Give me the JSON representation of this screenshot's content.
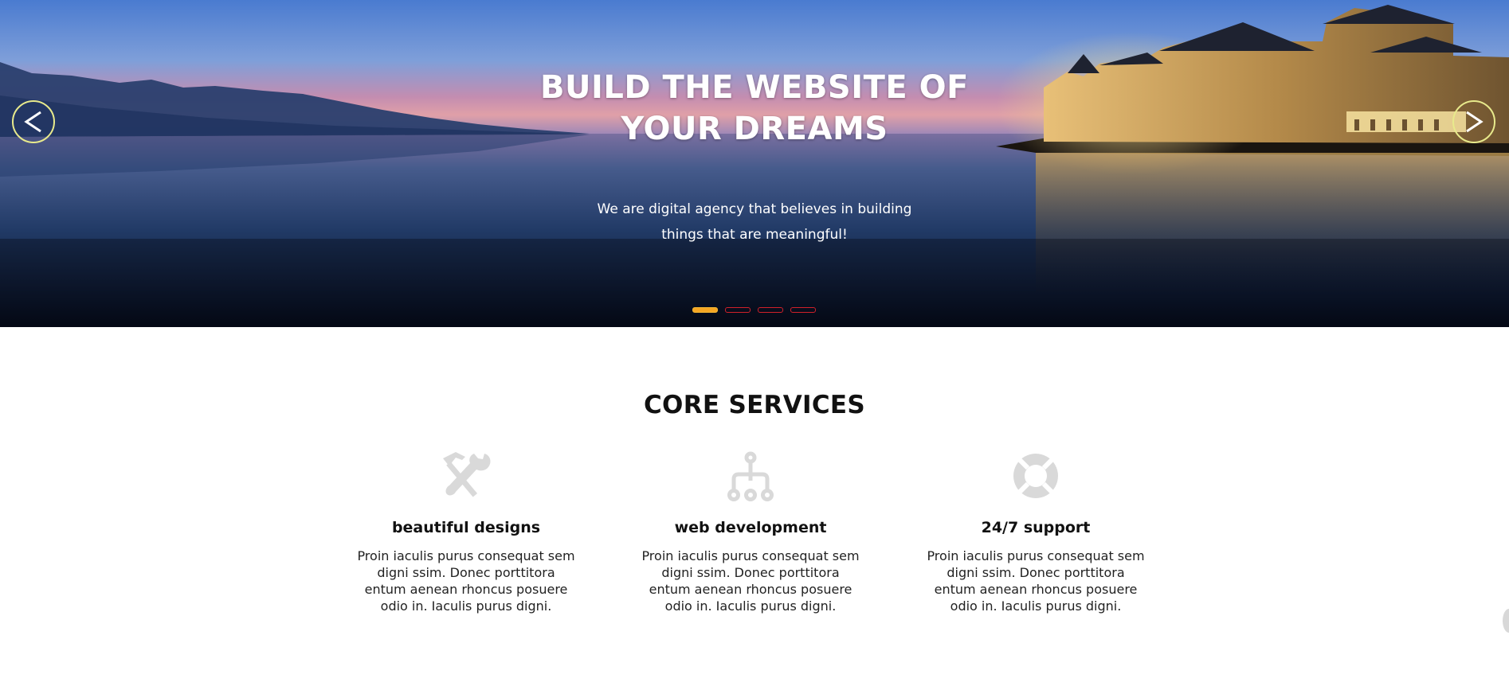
{
  "hero": {
    "title_line1": "BUILD THE WEBSITE OF",
    "title_line2": "YOUR DREAMS",
    "subtitle_line1": "We are digital agency that believes in building",
    "subtitle_line2": "things that are meaningful!",
    "prev_icon": "chevron-left-icon",
    "next_icon": "chevron-right-icon",
    "slide_count": 4,
    "active_slide": 1,
    "colors": {
      "arrow_ring": "#e8ea8c",
      "dot_active": "#f5a623",
      "dot_border": "#d0202a"
    }
  },
  "services": {
    "title": "CORE SERVICES",
    "items": [
      {
        "icon": "tools-icon",
        "name": "beautiful designs",
        "text": "Proin iaculis purus consequat sem digni ssim. Donec porttitora entum aenean rhoncus posuere odio in. Iaculis purus digni."
      },
      {
        "icon": "sitemap-icon",
        "name": "web development",
        "text": "Proin iaculis purus consequat sem digni ssim. Donec porttitora entum aenean rhoncus posuere odio in. Iaculis purus digni."
      },
      {
        "icon": "lifebuoy-icon",
        "name": "24/7 support",
        "text": "Proin iaculis purus consequat sem digni ssim. Donec porttitora entum aenean rhoncus posuere odio in. Iaculis purus digni."
      }
    ],
    "icon_color": "#d9d9d9"
  }
}
